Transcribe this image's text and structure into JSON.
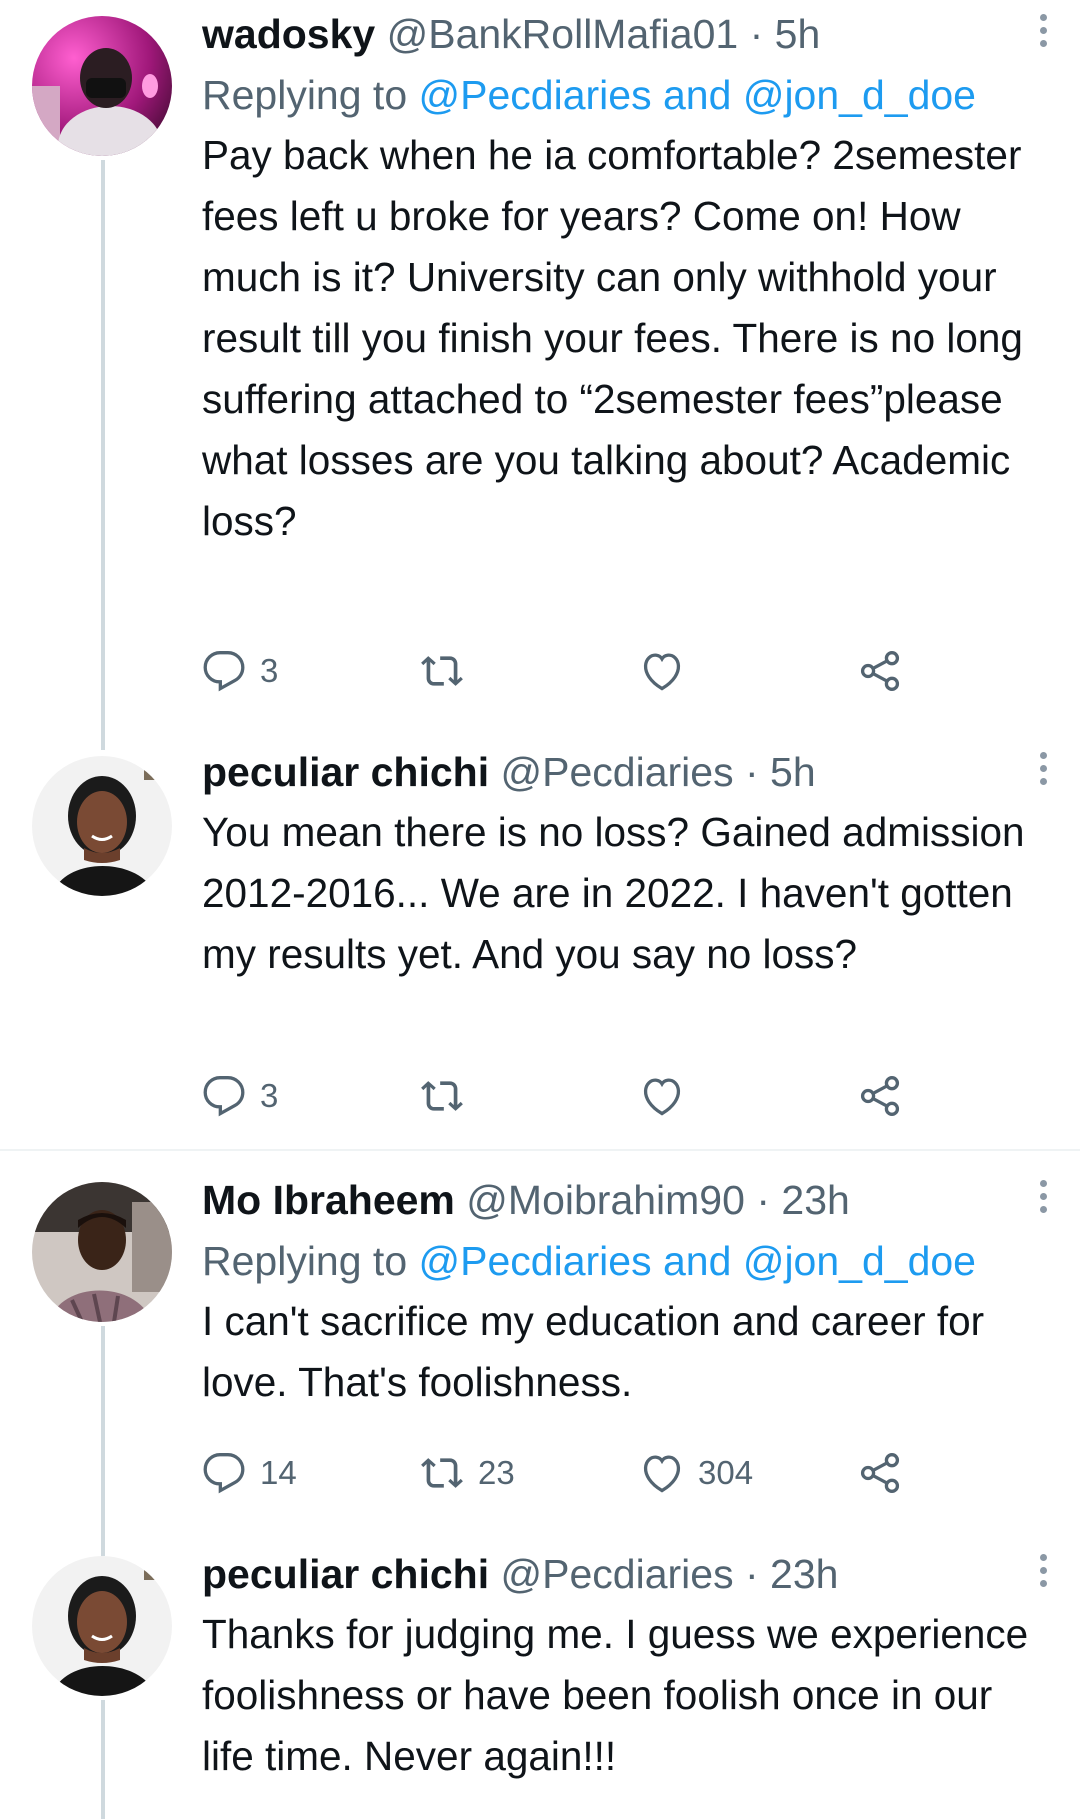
{
  "tweets": [
    {
      "name": "wadosky",
      "handle": "@BankRollMafia01",
      "time": "5h",
      "replying_prefix": "Replying to",
      "replying_to": [
        "@Pecdiaries",
        "@jon_d_doe"
      ],
      "replying_conj": "and",
      "text": "Pay back when he ia comfortable? 2semester fees left u broke for years? Come on! How much is it? University can only withhold your result till you finish your fees. There is no long suffering attached to “2semester fees”please what losses are you talking about? Academic loss?",
      "reply_count": "3",
      "retweet_count": "",
      "like_count": ""
    },
    {
      "name": "peculiar chichi",
      "handle": "@Pecdiaries",
      "time": "5h",
      "text": "You mean there is no loss? Gained admission 2012-2016... We are in 2022. I haven't gotten my results yet. And you say no loss?",
      "reply_count": "3",
      "retweet_count": "",
      "like_count": ""
    },
    {
      "name": "Mo Ibraheem",
      "handle": "@Moibrahim90",
      "time": "23h",
      "replying_prefix": "Replying to",
      "replying_to": [
        "@Pecdiaries",
        "@jon_d_doe"
      ],
      "replying_conj": "and",
      "text": "I can't sacrifice my education and career for love. That's foolishness.",
      "reply_count": "14",
      "retweet_count": "23",
      "like_count": "304"
    },
    {
      "name": "peculiar chichi",
      "handle": "@Pecdiaries",
      "time": "23h",
      "text": "Thanks for judging me. I guess we experience foolishness or have been foolish once in our life time. Never again!!!"
    }
  ],
  "separator": "·",
  "icons": {
    "reply": "reply-icon",
    "retweet": "retweet-icon",
    "like": "heart-icon",
    "share": "share-icon",
    "more": "more-options-icon"
  },
  "colors": {
    "text": "#0f1419",
    "secondary": "#536471",
    "link": "#1d9bf0",
    "thread_line": "#cfd9de"
  }
}
